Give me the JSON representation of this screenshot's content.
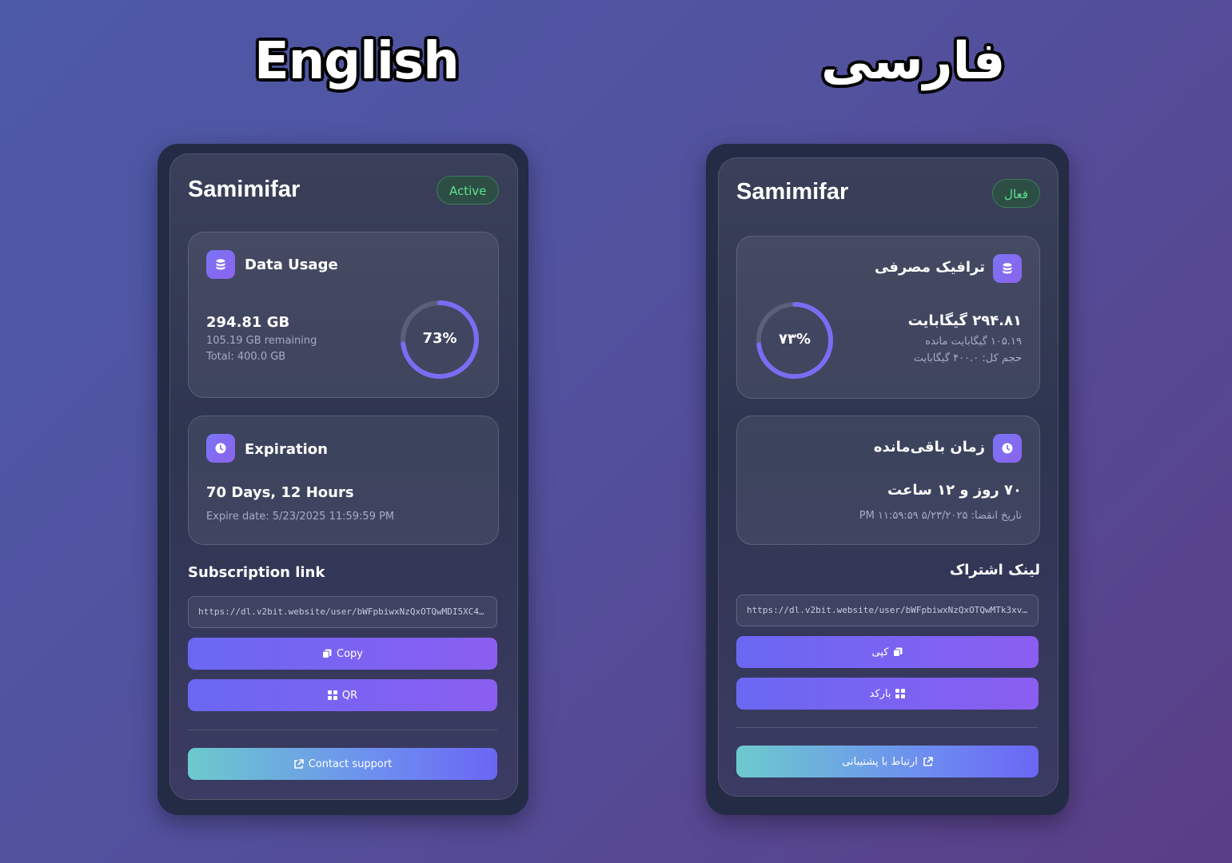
{
  "headings": {
    "english": "English",
    "farsi": "فارسی"
  },
  "colors": {
    "accent": "#7b6cf4",
    "active_green": "#5ce38f",
    "ring_track": "#5a5f7a"
  },
  "english_card": {
    "username": "Samimifar",
    "status": "Active",
    "data_usage": {
      "title": "Data Usage",
      "used": "294.81 GB",
      "remaining": "105.19 GB remaining",
      "total": "Total: 400.0 GB",
      "percent_label": "73%",
      "percent": 73
    },
    "expiration": {
      "title": "Expiration",
      "remaining": "70 Days, 12 Hours",
      "expire_date": "Expire date: 5/23/2025 11:59:59 PM"
    },
    "subscription": {
      "title": "Subscription link",
      "url": "https://dl.v2bit.website/user/bWFpbiwxNzQxOTQwMDI5XC4j…",
      "copy_label": "Copy",
      "qr_label": "QR"
    },
    "support_label": "Contact support"
  },
  "farsi_card": {
    "username": "Samimifar",
    "status": "فعال",
    "data_usage": {
      "title": "ترافیک مصرفی",
      "used": "۲۹۴.۸۱ گیگابایت",
      "remaining": "۱۰۵.۱۹ گیگابایت مانده",
      "total": "حجم کل: ۴۰۰.۰ گیگابایت",
      "percent_label": "۷۳%",
      "percent": 73
    },
    "expiration": {
      "title": "زمان باقی‌مانده",
      "remaining": "۷۰ روز و ۱۲ ساعت",
      "expire_date": "تاریخ انقضا: ۵/۲۳/۲۰۲۵ ۱۱:۵۹:۵۹ PM"
    },
    "subscription": {
      "title": "لینک اشتراک",
      "url": "https://dl.v2bit.website/user/bWFpbiwxNzQxOTQwMTk3xvc_…",
      "copy_label": "کپی",
      "qr_label": "بارکد"
    },
    "support_label": "ارتباط با پشتیبانی"
  },
  "icons": {
    "data": "database-icon",
    "time": "clock-icon",
    "copy": "copy-icon",
    "qr": "qr-grid-icon",
    "support": "external-link-icon"
  }
}
